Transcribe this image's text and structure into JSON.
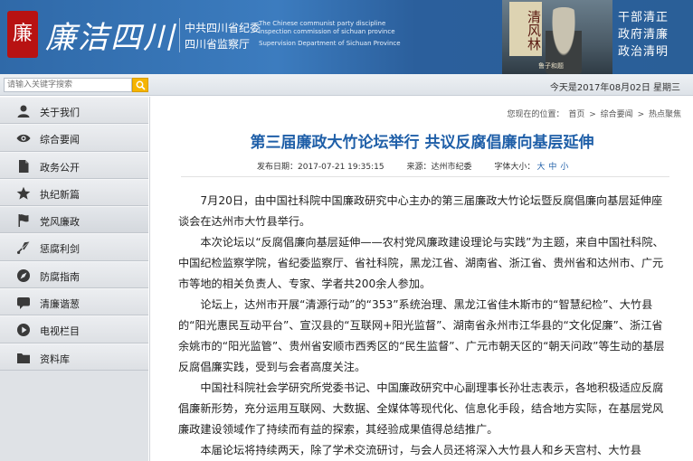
{
  "banner": {
    "seal_char": "廉",
    "calligraphy": "廉洁四川",
    "org_line1": "中共四川省纪委",
    "org_line2": "四川省监察厅",
    "eng_line1": "The Chinese communist party discipline",
    "eng_line2": "inspection commission of sichuan province",
    "eng_line3": "Supervision Department of Sichuan Province",
    "plaque": "清风林",
    "photo_sign": "鲁子和题",
    "slogans": [
      "干部清正",
      "政府清廉",
      "政治清明"
    ]
  },
  "search": {
    "placeholder": "请输入关键字搜索",
    "icon": "search-icon"
  },
  "date_text": "今天是2017年08月02日 星期三",
  "sidebar": {
    "items": [
      {
        "label": "关于我们",
        "icon": "user-icon"
      },
      {
        "label": "综合要闻",
        "icon": "eye-icon"
      },
      {
        "label": "政务公开",
        "icon": "document-icon"
      },
      {
        "label": "执纪新篇",
        "icon": "star-icon"
      },
      {
        "label": "党风廉政",
        "icon": "flag-icon"
      },
      {
        "label": "惩腐利剑",
        "icon": "sword-icon"
      },
      {
        "label": "防腐指南",
        "icon": "compass-icon"
      },
      {
        "label": "清廉谐葱",
        "icon": "chat-icon"
      },
      {
        "label": "电视栏目",
        "icon": "play-icon"
      },
      {
        "label": "资料库",
        "icon": "folder-icon"
      }
    ]
  },
  "breadcrumb": {
    "prefix": "您现在的位置：",
    "items": [
      "首页",
      "综合要闻",
      "热点聚焦"
    ],
    "separator": ">"
  },
  "article": {
    "title": "第三届廉政大竹论坛举行 共议反腐倡廉向基层延伸",
    "publish": "发布日期：2017-07-21 19:35:15",
    "source": "来源：达州市纪委",
    "font_size_label": "字体大小：",
    "font_sizes": [
      "大",
      "中",
      "小"
    ],
    "paragraphs": [
      "7月20日，由中国社科院中国廉政研究中心主办的第三届廉政大竹论坛暨反腐倡廉向基层延伸座谈会在达州市大竹县举行。",
      "本次论坛以“反腐倡廉向基层延伸——农村党风廉政建设理论与实践”为主题，来自中国社科院、中国纪检监察学院，省纪委监察厅、省社科院，黑龙江省、湖南省、浙江省、贵州省和达州市、广元市等地的相关负责人、专家、学者共200余人参加。",
      "论坛上，达州市开展“清源行动”的“353”系统治理、黑龙江省佳木斯市的“智慧纪检”、大竹县的“阳光惠民互动平台”、宣汉县的“互联网+阳光监督”、湖南省永州市江华县的“文化促廉”、浙江省余姚市的“阳光监管”、贵州省安顺市西秀区的“民生监督”、广元市朝天区的“朝天问政”等生动的基层反腐倡廉实践，受到与会者高度关注。",
      "中国社科院社会学研究所党委书记、中国廉政研究中心副理事长孙壮志表示，各地积极适应反腐倡廉新形势，充分运用互联网、大数据、全媒体等现代化、信息化手段，结合地方实际，在基层党风廉政建设领域作了持续而有益的探索，其经验成果值得总结推广。",
      "本届论坛将持续两天，除了学术交流研讨，与会人员还将深入大竹县人和乡天宫村、大竹县"
    ]
  },
  "colors": {
    "banner_blue": "#3c7cbf",
    "title_blue": "#1f5fa8",
    "search_button": "#f5b400",
    "seal_red": "#b81212"
  }
}
